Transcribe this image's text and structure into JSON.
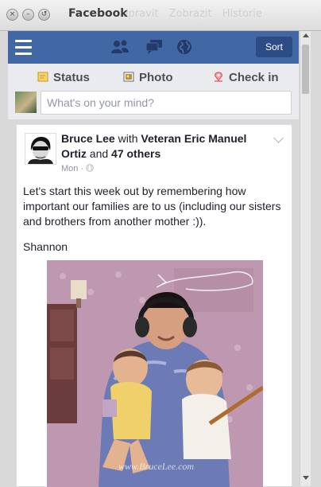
{
  "window": {
    "title": "Facebook",
    "menu": [
      "Upravit",
      "Zobrazit",
      "Historie"
    ]
  },
  "toolbar": {
    "sort_label": "Sort"
  },
  "composer": {
    "tabs": [
      "Status",
      "Photo",
      "Check in"
    ],
    "placeholder": "What's on your mind?"
  },
  "post": {
    "author": "Bruce Lee",
    "with_word": "with",
    "tagged": "Veteran Eric Manuel Ortiz",
    "and_word": "and",
    "others": "47 others",
    "time": "Mon",
    "text": "Let's start this week out by remembering how important our families are to us (including our sisters and brothers from another mother :)).",
    "signature": "Shannon",
    "photo_watermark": "www.BruceLee.com"
  },
  "colors": {
    "brand_blue": "#4267a5",
    "sort_button": "#2d4c86",
    "status_icon": "#e8b23a",
    "checkin_icon": "#e0595f"
  }
}
